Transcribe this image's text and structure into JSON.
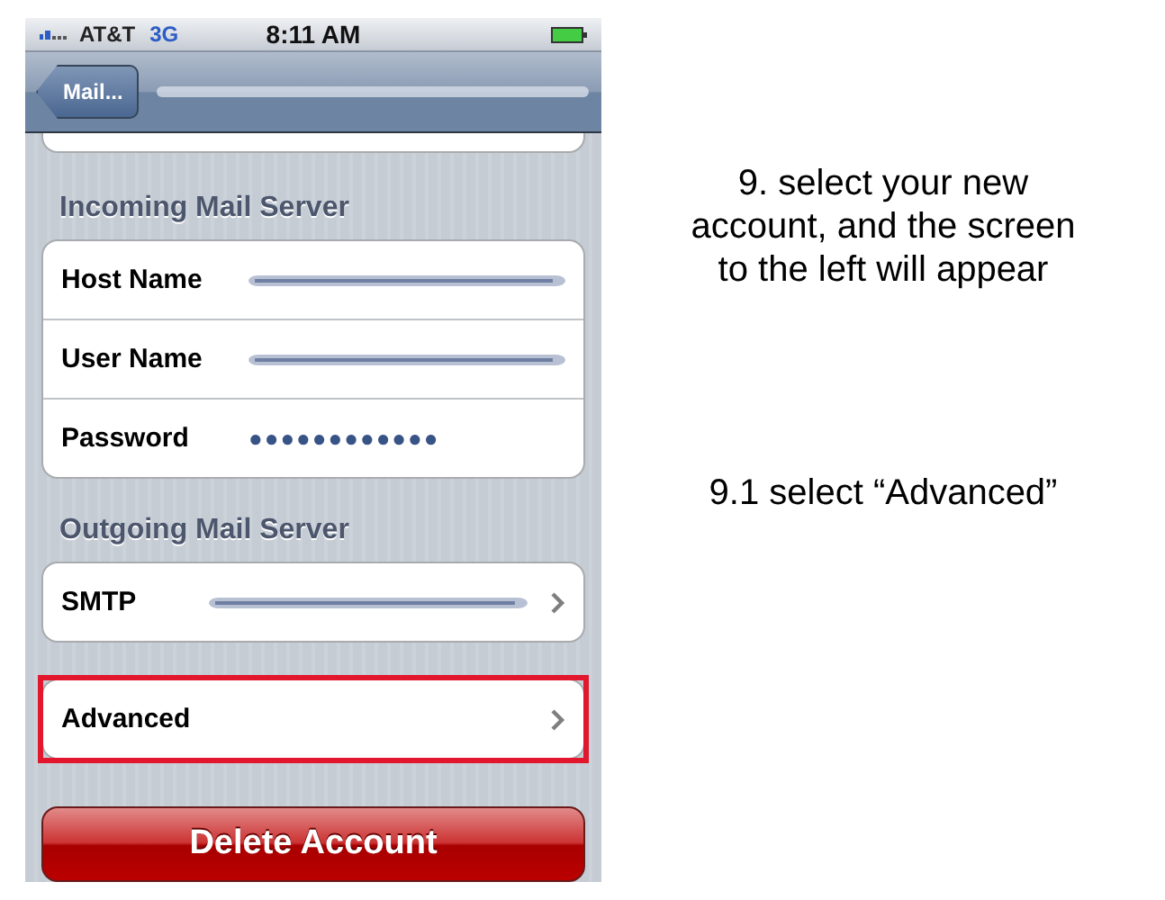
{
  "status_bar": {
    "carrier": "AT&T",
    "network": "3G",
    "time": "8:11 AM"
  },
  "nav_bar": {
    "back_button": "Mail..."
  },
  "sections": [
    {
      "header": "Incoming Mail Server",
      "rows": [
        {
          "label": "Host Name",
          "kind": "blurred",
          "chevron": false,
          "highlighted": false
        },
        {
          "label": "User Name",
          "kind": "blurred",
          "chevron": false,
          "highlighted": false
        },
        {
          "label": "Password",
          "kind": "password",
          "value": "●●●●●●●●●●●●",
          "chevron": false,
          "highlighted": false
        }
      ]
    },
    {
      "header": "Outgoing Mail Server",
      "rows": [
        {
          "label": "SMTP",
          "kind": "blurred",
          "chevron": true,
          "highlighted": false
        }
      ]
    },
    {
      "rows": [
        {
          "label": "Advanced",
          "kind": "plain",
          "chevron": true,
          "highlighted": true
        }
      ]
    }
  ],
  "delete_button": "Delete Account",
  "annotations": [
    {
      "text": "9. select your new account, and the screen to the left will appear"
    },
    {
      "text": "9.1 select “Advanced”"
    }
  ]
}
